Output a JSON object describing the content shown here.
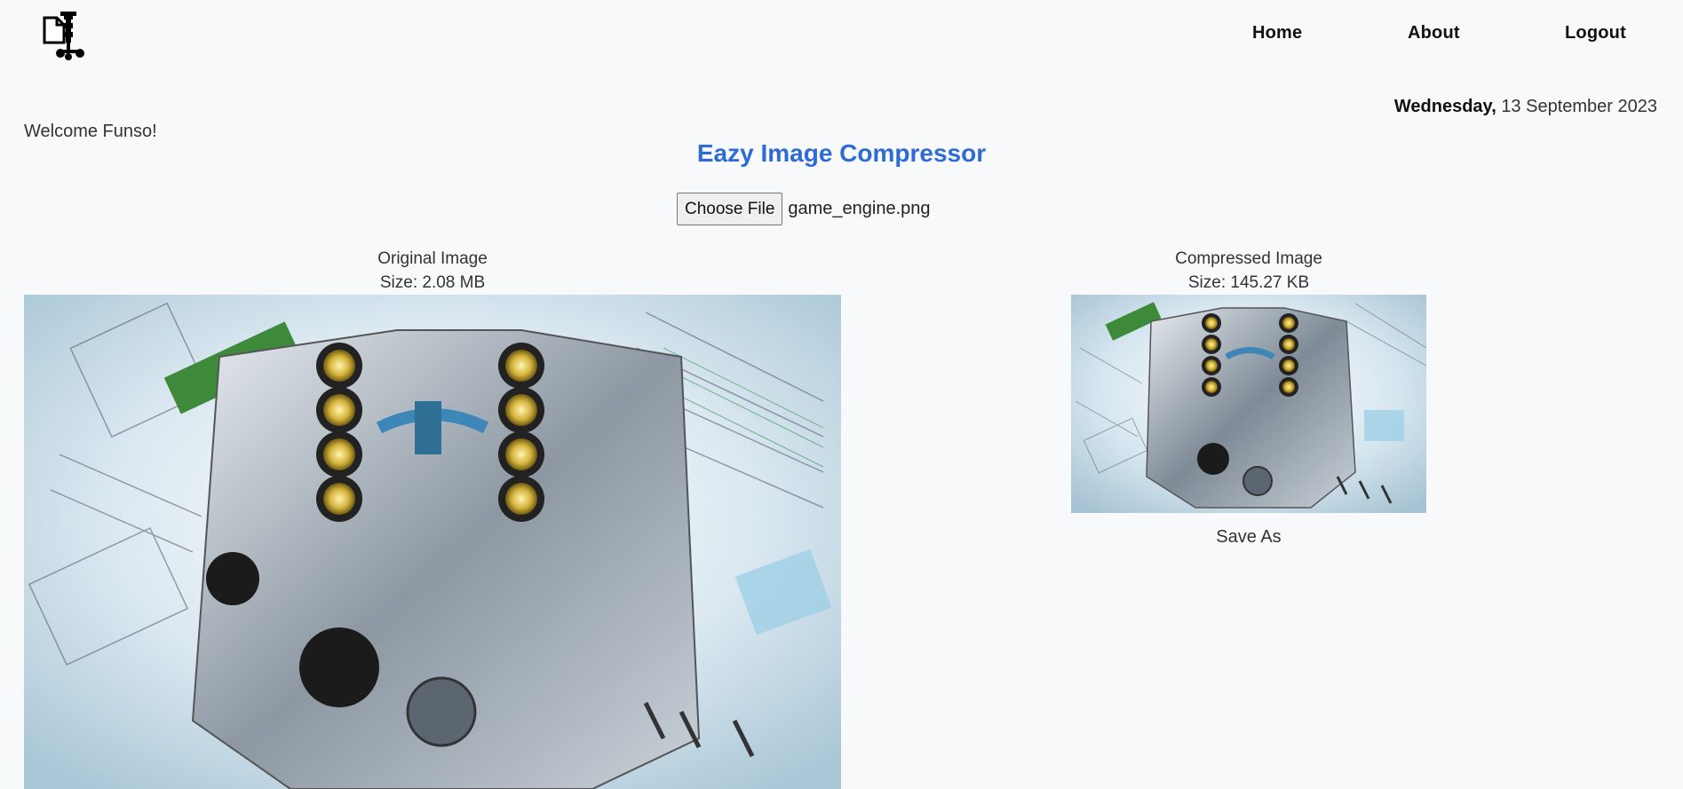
{
  "nav": {
    "logo_icon": "file-compress-icon",
    "links": [
      "Home",
      "About",
      "Logout"
    ]
  },
  "date": {
    "weekday": "Wednesday,",
    "rest": "13 September 2023"
  },
  "welcome": "Welcome Funso!",
  "title": "Eazy Image Compressor",
  "file_input": {
    "button_label": "Choose File",
    "file_name": "game_engine.png"
  },
  "original": {
    "label": "Original Image",
    "size": "Size: 2.08 MB",
    "image_icon": "engine-photo-image"
  },
  "compressed": {
    "label": "Compressed Image",
    "size": "Size: 145.27 KB",
    "image_icon": "engine-photo-image",
    "save_label": "Save As"
  },
  "colors": {
    "background": "#f7f9fb",
    "title": "#2f6bd5"
  }
}
